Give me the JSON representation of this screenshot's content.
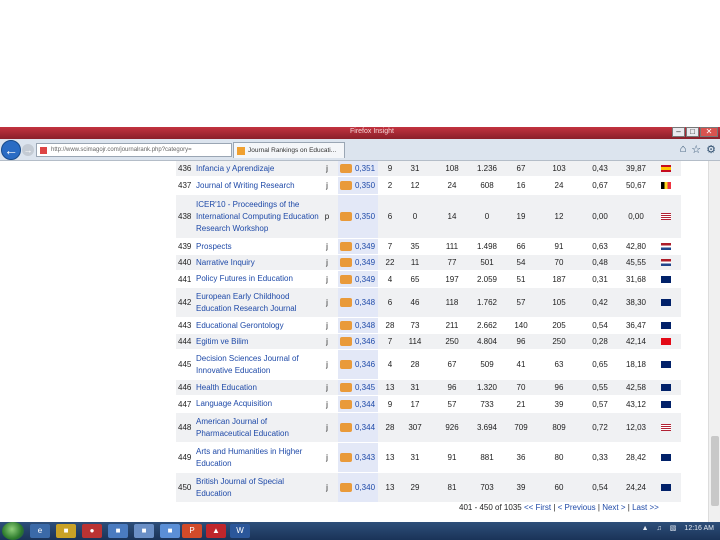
{
  "browser": {
    "window_title": "Firefox Insight",
    "address": "http://www.scimagojr.com/journalrank.php?category=",
    "tab_label": "Journal Rankings on Educati..."
  },
  "rows": [
    {
      "rank": "436",
      "title": "Infancia y Aprendizaje",
      "type": "j",
      "sjr": "0,351",
      "h": "9",
      "d": "31",
      "r": "108",
      "tc": "1.236",
      "cit": "67",
      "cd": "103",
      "cpd": "0,43",
      "rpd": "39,87",
      "flag": "spain"
    },
    {
      "rank": "437",
      "title": "Journal of Writing Research",
      "type": "j",
      "sjr": "0,350",
      "h": "2",
      "d": "12",
      "r": "24",
      "tc": "608",
      "cit": "16",
      "cd": "24",
      "cpd": "0,67",
      "rpd": "50,67",
      "flag": "belgium"
    },
    {
      "rank": "438",
      "title": "ICER'10 - Proceedings of the International Computing Education Research Workshop",
      "type": "p",
      "sjr": "0,350",
      "h": "6",
      "d": "0",
      "r": "14",
      "tc": "0",
      "cit": "19",
      "cd": "12",
      "cpd": "0,00",
      "rpd": "0,00",
      "flag": "usa"
    },
    {
      "rank": "439",
      "title": "Prospects",
      "type": "j",
      "sjr": "0,349",
      "h": "7",
      "d": "35",
      "r": "111",
      "tc": "1.498",
      "cit": "66",
      "cd": "91",
      "cpd": "0,63",
      "rpd": "42,80",
      "flag": "netherlands"
    },
    {
      "rank": "440",
      "title": "Narrative Inquiry",
      "type": "j",
      "sjr": "0,349",
      "h": "22",
      "d": "11",
      "r": "77",
      "tc": "501",
      "cit": "54",
      "cd": "70",
      "cpd": "0,48",
      "rpd": "45,55",
      "flag": "netherlands"
    },
    {
      "rank": "441",
      "title": "Policy Futures in Education",
      "type": "j",
      "sjr": "0,349",
      "h": "4",
      "d": "65",
      "r": "197",
      "tc": "2.059",
      "cit": "51",
      "cd": "187",
      "cpd": "0,31",
      "rpd": "31,68",
      "flag": "uk"
    },
    {
      "rank": "442",
      "title": "European Early Childhood Education Research Journal",
      "type": "j",
      "sjr": "0,348",
      "h": "6",
      "d": "46",
      "r": "118",
      "tc": "1.762",
      "cit": "57",
      "cd": "105",
      "cpd": "0,42",
      "rpd": "38,30",
      "flag": "uk"
    },
    {
      "rank": "443",
      "title": "Educational Gerontology",
      "type": "j",
      "sjr": "0,348",
      "h": "28",
      "d": "73",
      "r": "211",
      "tc": "2.662",
      "cit": "140",
      "cd": "205",
      "cpd": "0,54",
      "rpd": "36,47",
      "flag": "uk"
    },
    {
      "rank": "444",
      "title": "Egitim ve Bilim",
      "type": "j",
      "sjr": "0,346",
      "h": "7",
      "d": "114",
      "r": "250",
      "tc": "4.804",
      "cit": "96",
      "cd": "250",
      "cpd": "0,28",
      "rpd": "42,14",
      "flag": "turkey"
    },
    {
      "rank": "445",
      "title": "Decision Sciences Journal of Innovative Education",
      "type": "j",
      "sjr": "0,346",
      "h": "4",
      "d": "28",
      "r": "67",
      "tc": "509",
      "cit": "41",
      "cd": "63",
      "cpd": "0,65",
      "rpd": "18,18",
      "flag": "uk"
    },
    {
      "rank": "446",
      "title": "Health Education",
      "type": "j",
      "sjr": "0,345",
      "h": "13",
      "d": "31",
      "r": "96",
      "tc": "1.320",
      "cit": "70",
      "cd": "96",
      "cpd": "0,55",
      "rpd": "42,58",
      "flag": "uk"
    },
    {
      "rank": "447",
      "title": "Language Acquisition",
      "type": "j",
      "sjr": "0,344",
      "h": "9",
      "d": "17",
      "r": "57",
      "tc": "733",
      "cit": "21",
      "cd": "39",
      "cpd": "0,57",
      "rpd": "43,12",
      "flag": "uk"
    },
    {
      "rank": "448",
      "title": "American Journal of Pharmaceutical Education",
      "type": "j",
      "sjr": "0,344",
      "h": "28",
      "d": "307",
      "r": "926",
      "tc": "3.694",
      "cit": "709",
      "cd": "809",
      "cpd": "0,72",
      "rpd": "12,03",
      "flag": "usa"
    },
    {
      "rank": "449",
      "title": "Arts and Humanities in Higher Education",
      "type": "j",
      "sjr": "0,343",
      "h": "13",
      "d": "31",
      "r": "91",
      "tc": "881",
      "cit": "36",
      "cd": "80",
      "cpd": "0,33",
      "rpd": "28,42",
      "flag": "uk"
    },
    {
      "rank": "450",
      "title": "British Journal of Special Education",
      "type": "j",
      "sjr": "0,340",
      "h": "13",
      "d": "29",
      "r": "81",
      "tc": "703",
      "cit": "39",
      "cd": "60",
      "cpd": "0,54",
      "rpd": "24,24",
      "flag": "uk"
    }
  ],
  "pager": {
    "range": "401 - 450 of 1035",
    "first": "<< First",
    "previous": "< Previous",
    "next": "Next >",
    "last": "Last >>",
    "sep": "|"
  },
  "taskbar": {
    "clock": "12:16 AM"
  },
  "colors": {
    "link": "#1f4aa8",
    "sjr_highlight": "#e3e8f7",
    "sjr_badge": "#e99a3a"
  }
}
